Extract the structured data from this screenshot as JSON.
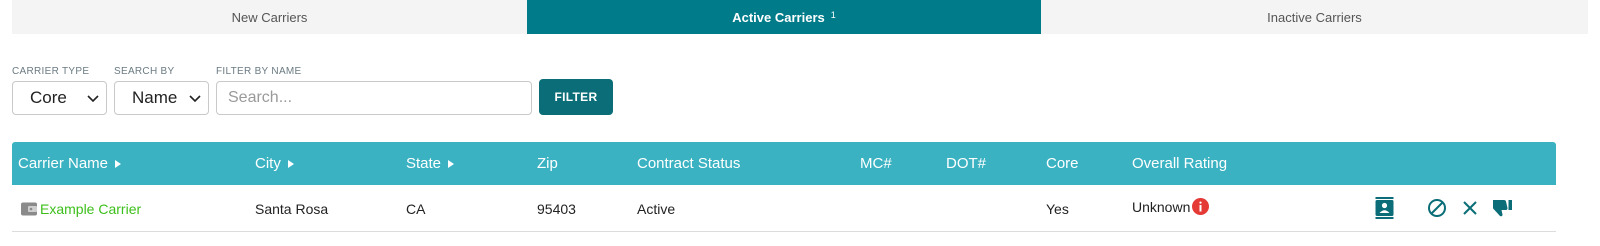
{
  "tabs": [
    {
      "label": "New Carriers",
      "active": false
    },
    {
      "label": "Active Carriers",
      "active": true,
      "badge": "1"
    },
    {
      "label": "Inactive Carriers",
      "active": false
    }
  ],
  "filters": {
    "carrier_type": {
      "label": "CARRIER TYPE",
      "value": "Core"
    },
    "search_by": {
      "label": "SEARCH BY",
      "value": "Name"
    },
    "filter_by_name": {
      "label": "FILTER BY NAME",
      "placeholder": "Search..."
    },
    "filter_button": "FILTER"
  },
  "table": {
    "columns": [
      "Carrier Name",
      "City",
      "State",
      "Zip",
      "Contract Status",
      "MC#",
      "DOT#",
      "Core",
      "Overall Rating"
    ],
    "rows": [
      {
        "carrier_name": "Example Carrier",
        "city": "Santa Rosa",
        "state": "CA",
        "zip": "95403",
        "contract_status": "Active",
        "mc": "",
        "dot": "",
        "core": "Yes",
        "overall_rating": "Unknown"
      }
    ]
  },
  "icons": {
    "wallet": "wallet-icon",
    "info": "info-icon",
    "contact": "contact-card-icon",
    "block": "block-icon",
    "close": "close-icon",
    "thumbs_down": "thumbs-down-icon",
    "sort": "sort-caret-icon",
    "chevron": "chevron-down-icon"
  },
  "colors": {
    "active_tab": "#007b8a",
    "header": "#3ab2c2",
    "filter_button": "#0b6d77",
    "link": "#3cbf1a",
    "info_badge": "#e53935",
    "action_icons": "#0b6d77"
  }
}
